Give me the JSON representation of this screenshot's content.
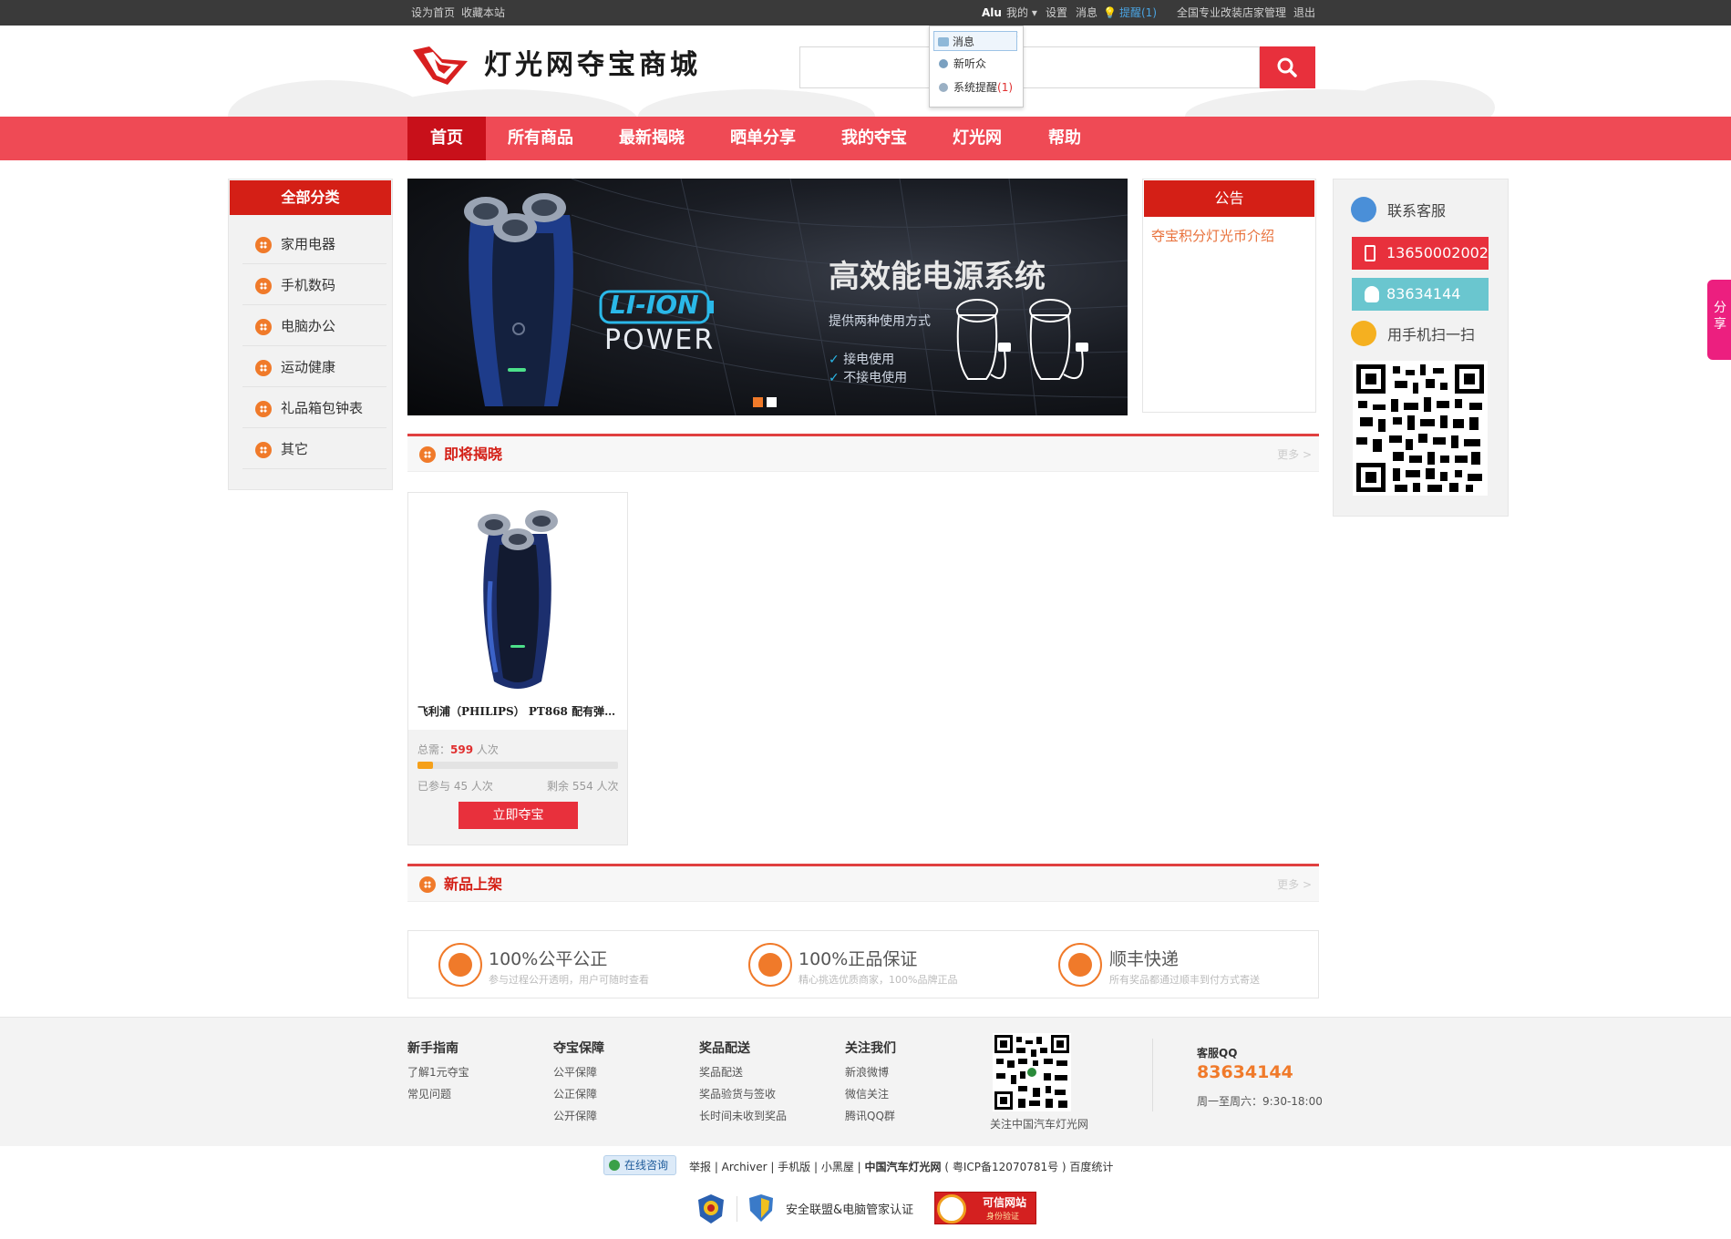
{
  "topbar": {
    "left_links": [
      "设为首页",
      "收藏本站"
    ],
    "username": "Alu",
    "my_label": "我的",
    "settings": "设置",
    "messages": "消息",
    "reminder": "提醒(1)",
    "store_admin": "全国专业改装店家管理",
    "logout": "退出"
  },
  "dropdown": {
    "items": [
      "消息",
      "新听众",
      "系统提醒"
    ],
    "reminder_count": "(1)"
  },
  "header": {
    "logo_text": "灯光网夺宝商城",
    "search_placeholder": ""
  },
  "nav": {
    "items": [
      "首页",
      "所有商品",
      "最新揭晓",
      "晒单分享",
      "我的夺宝",
      "灯光网",
      "帮助"
    ],
    "active_index": 0
  },
  "categories": {
    "title": "全部分类",
    "items": [
      "家用电器",
      "手机数码",
      "电脑办公",
      "运动健康",
      "礼品箱包钟表",
      "其它"
    ]
  },
  "banner": {
    "brand_top": "LI-ION",
    "brand_bottom": "POWER",
    "headline": "高效能电源系统",
    "subline": "提供两种使用方式",
    "opt1": "接电使用",
    "opt2": "不接电使用",
    "slides": 2,
    "active_slide": 0
  },
  "notice": {
    "title": "公告",
    "link": "夺宝积分灯光币介绍"
  },
  "contact": {
    "title": "联系客服",
    "phone": "13650002002",
    "qq": "83634144",
    "scan": "用手机扫一扫"
  },
  "section_upcoming": {
    "title": "即将揭晓",
    "more": "更多 >"
  },
  "product": {
    "name": "飞利浦（PHILIPS） PT868 配有弹性...",
    "total_label": "总需：",
    "total_value": "599",
    "total_unit": " 人次",
    "joined_label": "已参与 45 人次",
    "remain_label": "剩余 554 人次",
    "progress_fraction": 0.075,
    "buy_label": "立即夺宝"
  },
  "section_new": {
    "title": "新品上架",
    "more": "更多 >"
  },
  "guarantees": [
    {
      "title": "100%公平公正",
      "sub": "参与过程公开透明，用户可随时查看",
      "icon": "scale-icon"
    },
    {
      "title": "100%正品保证",
      "sub": "精心挑选优质商家，100%品牌正品",
      "icon": "shield-icon"
    },
    {
      "title": "顺丰快递",
      "sub": "所有奖品都通过顺丰到付方式寄送",
      "icon": "truck-icon"
    }
  ],
  "footer": {
    "cols": [
      {
        "title": "新手指南",
        "links": [
          "了解1元夺宝",
          "常见问题"
        ]
      },
      {
        "title": "夺宝保障",
        "links": [
          "公平保障",
          "公正保障",
          "公开保障"
        ]
      },
      {
        "title": "奖品配送",
        "links": [
          "奖品配送",
          "奖品验货与签收",
          "长时间未收到奖品"
        ]
      },
      {
        "title": "关注我们",
        "links": [
          "新浪微博",
          "微信关注",
          "腾讯QQ群"
        ]
      }
    ],
    "qr_caption": "关注中国汽车灯光网",
    "qq_title": "客服QQ",
    "qq_number": "83634144",
    "hours": "周一至周六：9:30-18:00"
  },
  "bottom": {
    "consult": "在线咨询",
    "links": "举报 | Archiver | 手机版 | 小黑屋 |",
    "site_name": "中国汽车灯光网",
    "icp": "( 粤ICP备12070781号 ) 百度统计",
    "security": "安全联盟&电脑管家认证",
    "trusted": "可信网站",
    "trusted_sub": "身份验证"
  },
  "share": {
    "label": "分享"
  },
  "colors": {
    "nav": "#ef4a55",
    "active": "#c8101a",
    "accent_red": "#d41f16",
    "orange": "#f07a2a"
  }
}
